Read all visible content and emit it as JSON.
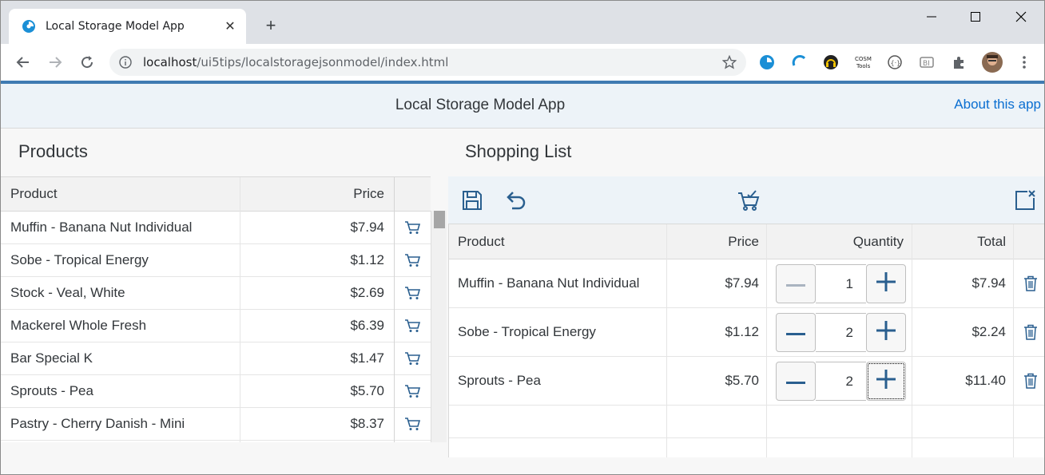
{
  "browser": {
    "tab_title": "Local Storage Model App",
    "url_host": "localhost",
    "url_path": "/ui5tips/localstoragejsonmodel/index.html"
  },
  "app": {
    "title": "Local Storage Model App",
    "about_link": "About this app"
  },
  "products": {
    "title": "Products",
    "columns": {
      "product": "Product",
      "price": "Price"
    },
    "rows": [
      {
        "name": "Muffin - Banana Nut Individual",
        "price": "$7.94"
      },
      {
        "name": "Sobe - Tropical Energy",
        "price": "$1.12"
      },
      {
        "name": "Stock - Veal, White",
        "price": "$2.69"
      },
      {
        "name": "Mackerel Whole Fresh",
        "price": "$6.39"
      },
      {
        "name": "Bar Special K",
        "price": "$1.47"
      },
      {
        "name": "Sprouts - Pea",
        "price": "$5.70"
      },
      {
        "name": "Pastry - Cherry Danish - Mini",
        "price": "$8.37"
      }
    ]
  },
  "shopping": {
    "title": "Shopping List",
    "columns": {
      "product": "Product",
      "price": "Price",
      "quantity": "Quantity",
      "total": "Total"
    },
    "rows": [
      {
        "name": "Muffin - Banana Nut Individual",
        "price": "$7.94",
        "quantity": "1",
        "total": "$7.94"
      },
      {
        "name": "Sobe - Tropical Energy",
        "price": "$1.12",
        "quantity": "2",
        "total": "$2.24"
      },
      {
        "name": "Sprouts - Pea",
        "price": "$5.70",
        "quantity": "2",
        "total": "$11.40"
      }
    ]
  },
  "colors": {
    "accent": "#0a6ed1",
    "icon": "#2a5f8f",
    "brand_line": "#3f7bb2"
  }
}
